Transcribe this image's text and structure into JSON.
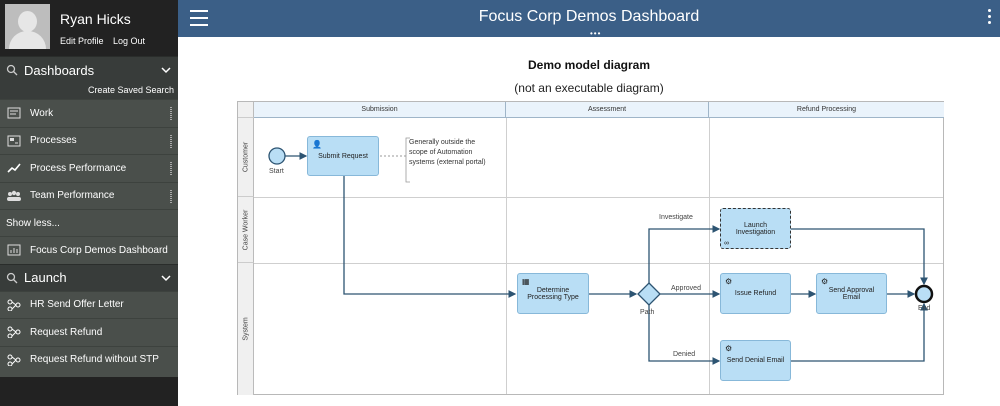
{
  "profile": {
    "name": "Ryan Hicks",
    "edit_label": "Edit Profile",
    "logout_label": "Log Out"
  },
  "sidebar": {
    "dashboards_label": "Dashboards",
    "create_saved_search": "Create Saved Search",
    "dashboard_items": [
      {
        "label": "Work",
        "icon": "work-icon"
      },
      {
        "label": "Processes",
        "icon": "processes-icon"
      },
      {
        "label": "Process Performance",
        "icon": "chart-icon"
      },
      {
        "label": "Team Performance",
        "icon": "team-icon"
      }
    ],
    "show_less": "Show less...",
    "focus_dashboard": "Focus Corp Demos Dashboard",
    "launch_label": "Launch",
    "launch_items": [
      {
        "label": "HR Send Offer Letter",
        "icon": "process-flow-icon"
      },
      {
        "label": "Request Refund",
        "icon": "process-flow-icon"
      },
      {
        "label": "Request Refund without STP",
        "icon": "process-flow-icon"
      }
    ]
  },
  "header": {
    "title": "Focus Corp Demos Dashboard",
    "color": "#3b5f87"
  },
  "main": {
    "diagram_title": "Demo model diagram",
    "diagram_subtitle": "(not an executable diagram)"
  },
  "diagram": {
    "phases": [
      "Submission",
      "Assessment",
      "Refund Processing"
    ],
    "lanes": [
      "Customer",
      "Case Worker",
      "System"
    ],
    "start_label": "Start",
    "end_label": "End",
    "gateway_label": "Path",
    "note": "Generally outside the scope of Automation systems (external portal)",
    "tasks": {
      "submit_request": "Submit Request",
      "determine_type": "Determine Processing Type",
      "launch_investigation": "Launch Investigation",
      "issue_refund": "Issue Refund",
      "send_approval": "Send Approval Email",
      "send_denial": "Send Denial Email"
    },
    "flow_labels": {
      "investigate": "Investigate",
      "approved": "Approved",
      "denied": "Denied"
    },
    "task_color": "#b9def5"
  }
}
